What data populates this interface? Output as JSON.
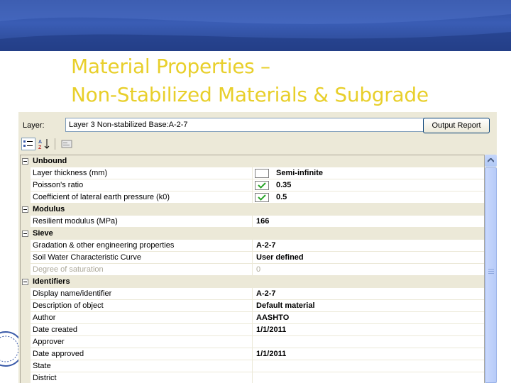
{
  "slide": {
    "title_line1": "Material Properties –",
    "title_line2": "Non-Stabilized Materials & Subgrade",
    "title_color": "#e8cf2b",
    "banner_color": "#2c4a9a"
  },
  "app": {
    "layer_label": "Layer:",
    "layer_value": "Layer 3 Non-stabilized Base:A-2-7",
    "output_button": "Output Report",
    "toolbar_icons": [
      "categorized-view-icon",
      "alphabetical-sort-icon",
      "property-pages-icon"
    ]
  },
  "grid": {
    "categories": [
      {
        "name": "Unbound",
        "properties": [
          {
            "name": "Layer thickness (mm)",
            "value": "Semi-infinite",
            "box": "empty",
            "disabled": false
          },
          {
            "name": "Poisson's ratio",
            "value": "0.35",
            "box": "check",
            "disabled": false
          },
          {
            "name": "Coefficient of lateral earth pressure (k0)",
            "value": "0.5",
            "box": "check",
            "disabled": false
          }
        ]
      },
      {
        "name": "Modulus",
        "properties": [
          {
            "name": "Resilient modulus (MPa)",
            "value": "166",
            "box": "none",
            "disabled": false
          }
        ]
      },
      {
        "name": "Sieve",
        "properties": [
          {
            "name": "Gradation & other engineering properties",
            "value": "A-2-7",
            "box": "none",
            "disabled": false
          },
          {
            "name": "Soil Water Characteristic Curve",
            "value": "User defined",
            "box": "none",
            "disabled": false
          },
          {
            "name": "Degree of saturation",
            "value": "0",
            "box": "none",
            "disabled": true
          }
        ]
      },
      {
        "name": "Identifiers",
        "properties": [
          {
            "name": "Display name/identifier",
            "value": "A-2-7",
            "box": "none",
            "disabled": false
          },
          {
            "name": "Description of object",
            "value": "Default material",
            "box": "none",
            "disabled": false
          },
          {
            "name": "Author",
            "value": "AASHTO",
            "box": "none",
            "disabled": false
          },
          {
            "name": "Date created",
            "value": "1/1/2011",
            "box": "none",
            "disabled": false
          },
          {
            "name": "Approver",
            "value": "",
            "box": "none",
            "disabled": false
          },
          {
            "name": "Date approved",
            "value": "1/1/2011",
            "box": "none",
            "disabled": false
          },
          {
            "name": "State",
            "value": "",
            "box": "none",
            "disabled": false
          },
          {
            "name": "District",
            "value": "",
            "box": "none",
            "disabled": false
          }
        ]
      }
    ]
  }
}
